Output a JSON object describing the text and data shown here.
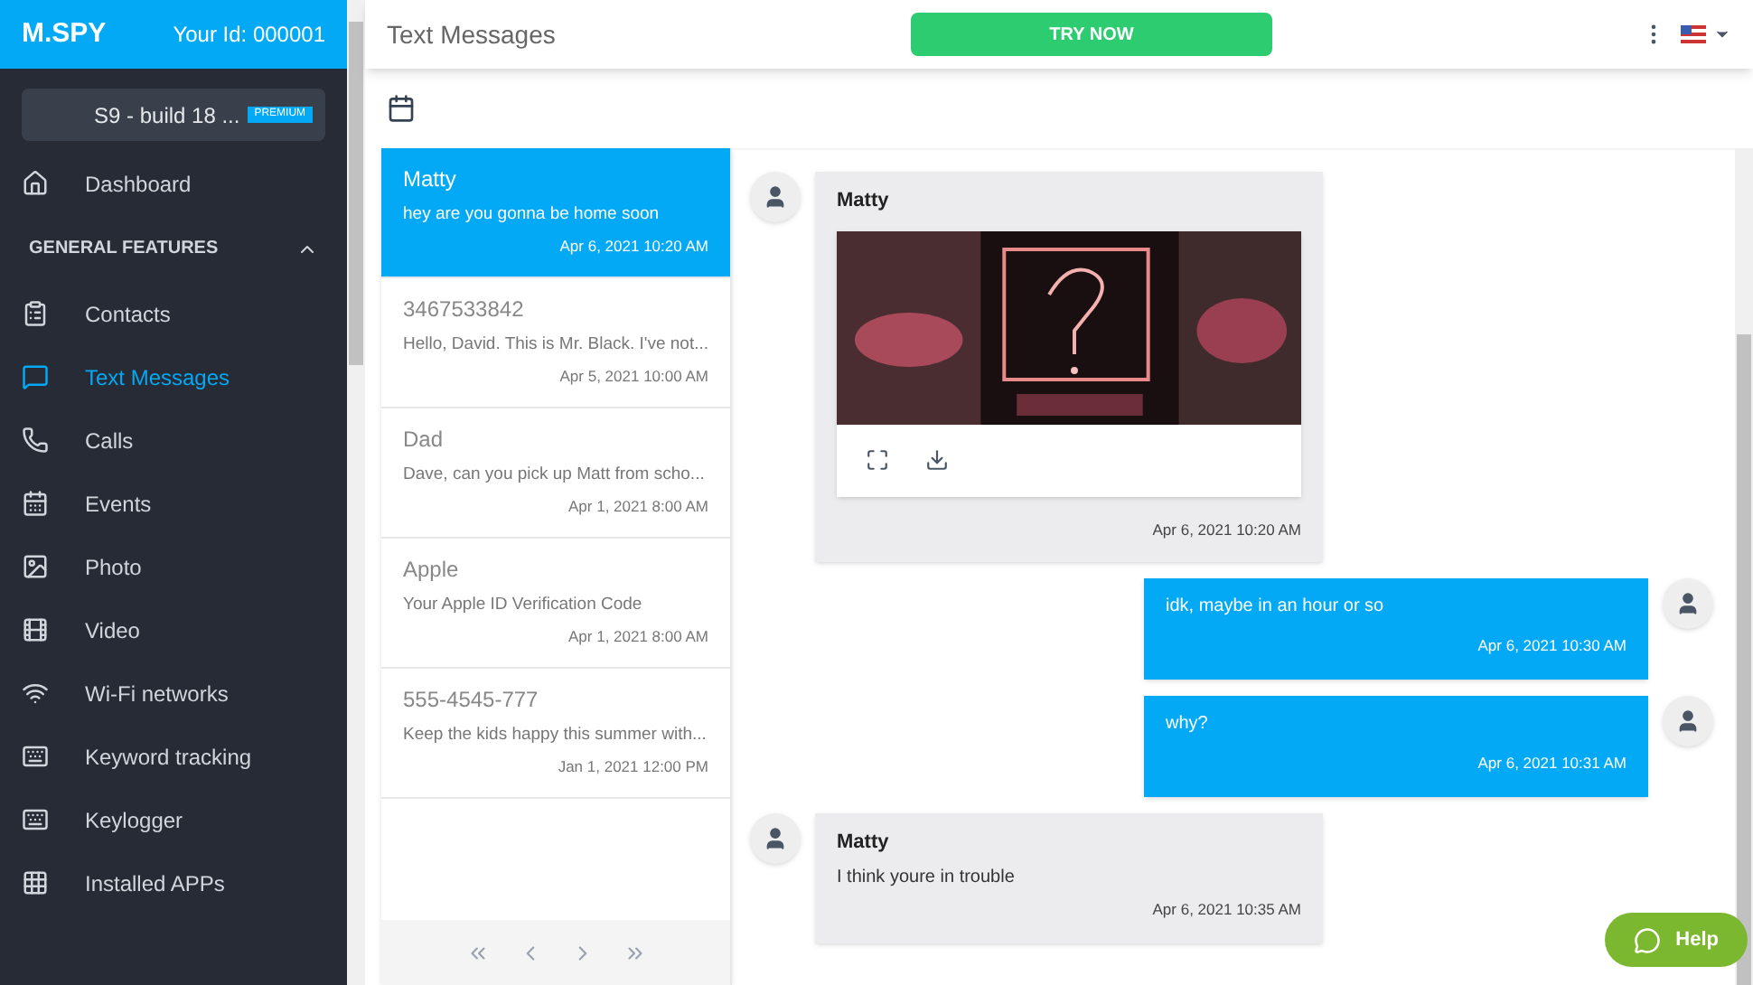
{
  "brand": {
    "logo": "M.SPY",
    "user_id": "Your Id: 000001"
  },
  "device": {
    "name": "S9 - build 18 ...",
    "badge": "PREMIUM"
  },
  "sidebar": {
    "items": [
      {
        "label": "Dashboard",
        "kind": "item",
        "selected": false
      },
      {
        "label": "GENERAL FEATURES",
        "kind": "section",
        "expanded": true
      },
      {
        "label": "Contacts",
        "kind": "item",
        "selected": false
      },
      {
        "label": "Text Messages",
        "kind": "item",
        "selected": true
      },
      {
        "label": "Calls",
        "kind": "item",
        "selected": false
      },
      {
        "label": "Events",
        "kind": "item",
        "selected": false
      },
      {
        "label": "Photo",
        "kind": "item",
        "selected": false
      },
      {
        "label": "Video",
        "kind": "item",
        "selected": false
      },
      {
        "label": "Wi-Fi networks",
        "kind": "item",
        "selected": false
      },
      {
        "label": "Keyword tracking",
        "kind": "item",
        "selected": false
      },
      {
        "label": "Keylogger",
        "kind": "item",
        "selected": false
      },
      {
        "label": "Installed APPs",
        "kind": "item",
        "selected": false
      }
    ]
  },
  "header": {
    "title": "Text Messages",
    "cta": "TRY NOW"
  },
  "conversations": [
    {
      "name": "Matty",
      "preview": "hey are you gonna be home soon",
      "time": "Apr 6, 2021 10:20 AM",
      "selected": true
    },
    {
      "name": "3467533842",
      "preview": "Hello, David. This is Mr. Black. I've not...",
      "time": "Apr 5, 2021 10:00 AM",
      "selected": false
    },
    {
      "name": "Dad",
      "preview": "Dave, can you pick up Matt from scho...",
      "time": "Apr 1, 2021 8:00 AM",
      "selected": false
    },
    {
      "name": "Apple",
      "preview": "Your Apple ID Verification Code",
      "time": "Apr 1, 2021 8:00 AM",
      "selected": false
    },
    {
      "name": "555-4545-777",
      "preview": "Keep the kids happy this summer with...",
      "time": "Jan 1, 2021 12:00 PM",
      "selected": false
    }
  ],
  "messages": [
    {
      "kind": "incoming",
      "sender": "Matty",
      "image": true,
      "time": "Apr 6, 2021 10:20 AM"
    },
    {
      "kind": "outgoing",
      "text": "idk, maybe in an hour or so",
      "time": "Apr 6, 2021 10:30 AM"
    },
    {
      "kind": "outgoing",
      "text": "why?",
      "time": "Apr 6, 2021 10:31 AM"
    },
    {
      "kind": "incoming",
      "sender": "Matty",
      "text": "I think youre in trouble",
      "time": "Apr 6, 2021 10:35 AM"
    }
  ],
  "help": "Help"
}
